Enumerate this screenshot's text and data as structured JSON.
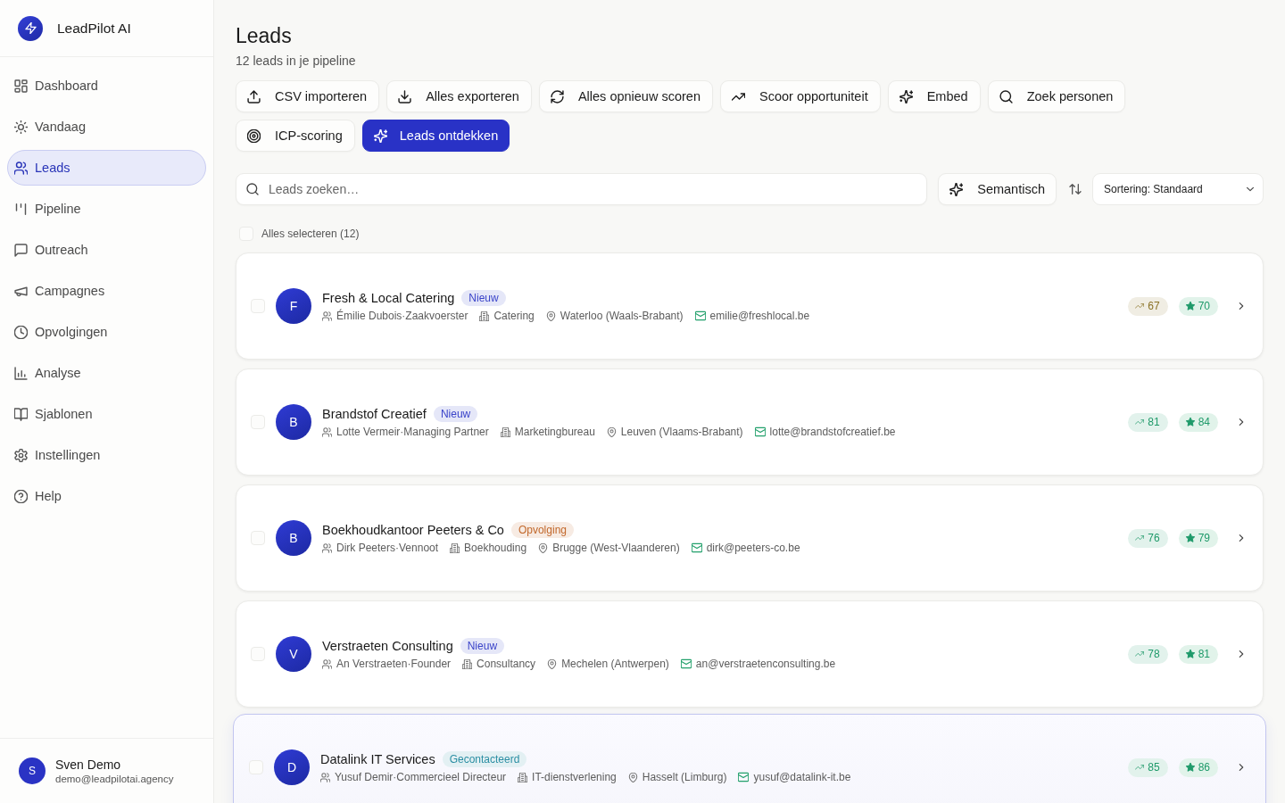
{
  "sidebar": {
    "brand": "LeadPilot AI",
    "items": [
      {
        "label": "Dashboard",
        "selected": false
      },
      {
        "label": "Vandaag",
        "selected": false
      },
      {
        "label": "Leads",
        "selected": true
      },
      {
        "label": "Pipeline",
        "selected": false
      },
      {
        "label": "Outreach",
        "selected": false
      },
      {
        "label": "Campagnes",
        "selected": false
      },
      {
        "label": "Opvolgingen",
        "selected": false
      },
      {
        "label": "Analyse",
        "selected": false
      },
      {
        "label": "Sjablonen",
        "selected": false
      },
      {
        "label": "Instellingen",
        "selected": false
      },
      {
        "label": "Help",
        "selected": false
      }
    ],
    "user": {
      "initial": "S",
      "name": "Sven Demo",
      "email": "demo@leadpilotai.agency"
    }
  },
  "header": {
    "title": "Leads",
    "subtitle": "12 leads in je pipeline"
  },
  "actions": [
    {
      "label": "CSV importeren",
      "kind": "secondary"
    },
    {
      "label": "Alles exporteren",
      "kind": "secondary"
    },
    {
      "label": "Alles opnieuw scoren",
      "kind": "secondary"
    },
    {
      "label": "Scoor opportuniteit",
      "kind": "secondary"
    },
    {
      "label": "Embed",
      "kind": "secondary"
    },
    {
      "label": "Zoek personen",
      "kind": "secondary"
    },
    {
      "label": "ICP-scoring",
      "kind": "secondary"
    },
    {
      "label": "Leads ontdekken",
      "kind": "primary"
    }
  ],
  "search": {
    "placeholder": "Leads zoeken…"
  },
  "semantic_button": {
    "label": "Semantisch"
  },
  "sort": {
    "value": "Sortering: Standaard"
  },
  "select_all": {
    "label": "Alles selecteren (12)",
    "checked": false
  },
  "leads": [
    {
      "initial": "F",
      "company": "Fresh & Local Catering",
      "status": {
        "label": "Nieuw",
        "color": "#3a43c9"
      },
      "contact": "Émilie Dubois·Zaakvoerster",
      "industry": "Catering",
      "location": "Waterloo (Waals-Brabant)",
      "email": "emilie@freshlocal.be",
      "opportunity": {
        "value": "67",
        "color": "#8a7226"
      },
      "score": "70",
      "checked": false,
      "selected": false
    },
    {
      "initial": "B",
      "company": "Brandstof Creatief",
      "status": {
        "label": "Nieuw",
        "color": "#3a43c9"
      },
      "contact": "Lotte Vermeir·Managing Partner",
      "industry": "Marketingbureau",
      "location": "Leuven (Vlaams-Brabant)",
      "email": "lotte@brandstofcreatief.be",
      "opportunity": {
        "value": "81",
        "color": "#1f9a6a"
      },
      "score": "84",
      "checked": false,
      "selected": false
    },
    {
      "initial": "B",
      "company": "Boekhoudkantoor Peeters & Co",
      "status": {
        "label": "Opvolging",
        "color": "#c2682b"
      },
      "contact": "Dirk Peeters·Vennoot",
      "industry": "Boekhouding",
      "location": "Brugge (West-Vlaanderen)",
      "email": "dirk@peeters-co.be",
      "opportunity": {
        "value": "76",
        "color": "#1f9a6a"
      },
      "score": "79",
      "checked": false,
      "selected": false
    },
    {
      "initial": "V",
      "company": "Verstraeten Consulting",
      "status": {
        "label": "Nieuw",
        "color": "#3a43c9"
      },
      "contact": "An Verstraeten·Founder",
      "industry": "Consultancy",
      "location": "Mechelen (Antwerpen)",
      "email": "an@verstraetenconsulting.be",
      "opportunity": {
        "value": "78",
        "color": "#1f9a6a"
      },
      "score": "81",
      "checked": false,
      "selected": false
    },
    {
      "initial": "D",
      "company": "Datalink IT Services",
      "status": {
        "label": "Gecontacteerd",
        "color": "#2b8ea3"
      },
      "contact": "Yusuf Demir·Commercieel Directeur",
      "industry": "IT-dienstverlening",
      "location": "Hasselt (Limburg)",
      "email": "yusuf@datalink-it.be",
      "opportunity": {
        "value": "85",
        "color": "#1f9a6a"
      },
      "score": "86",
      "checked": false,
      "selected": true
    }
  ]
}
